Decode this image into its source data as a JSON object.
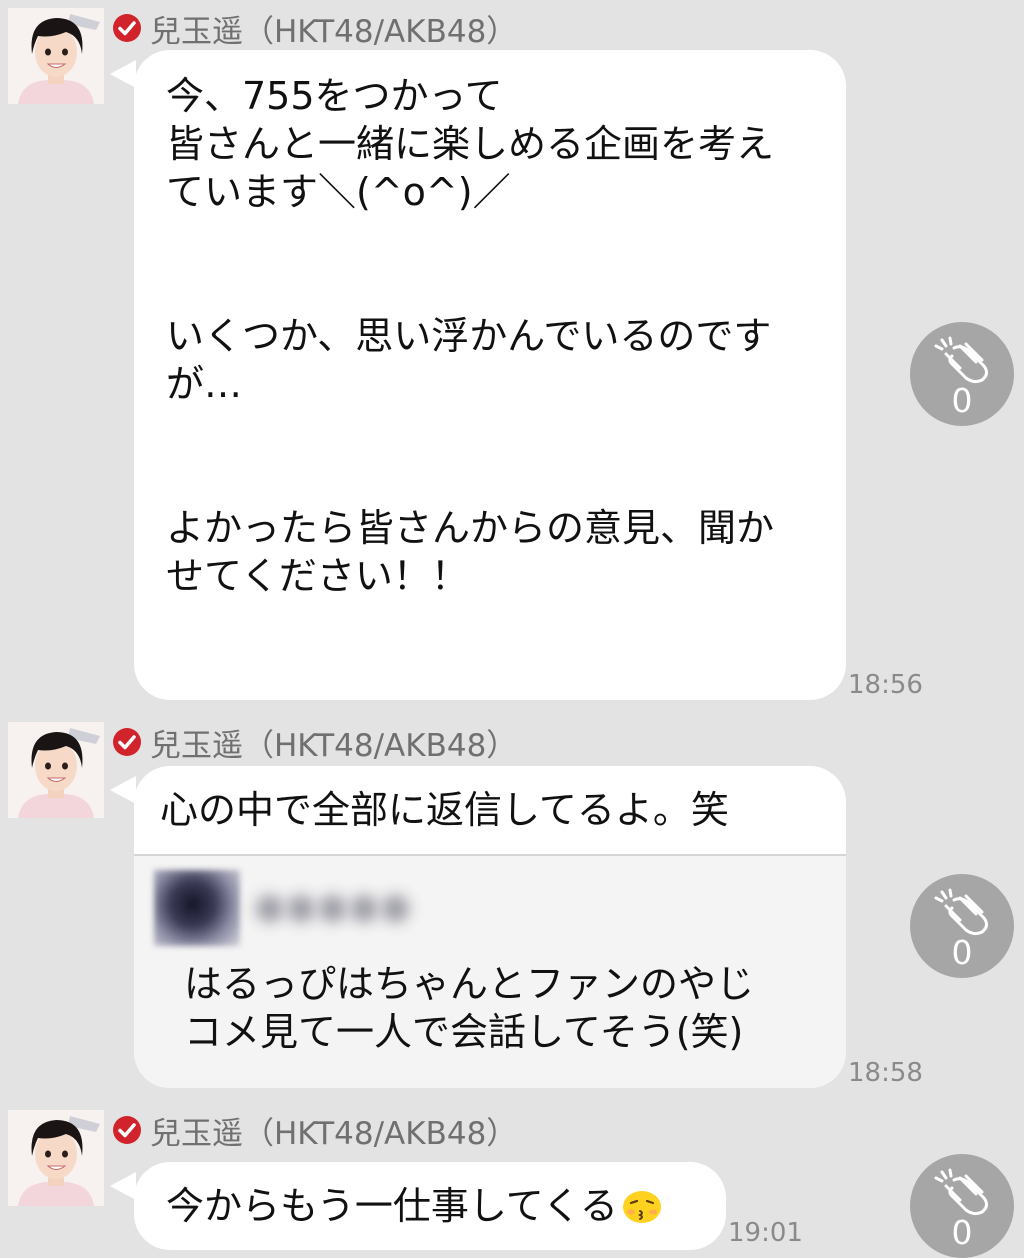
{
  "colors": {
    "background": "#e3e3e3",
    "bubble": "#ffffff",
    "verified_badge": "#d0232b",
    "clap_button": "#a6a6a6",
    "name_text": "#707070",
    "timestamp_text": "#8a8a8a"
  },
  "messages": [
    {
      "sender": "兒玉遥（HKT48/AKB48）",
      "avatar_icon": "profile-photo",
      "text": "今、755をつかって\n皆さんと一緒に楽しめる企画を考え\nています＼(^o^)／\n\n\nいくつか、思い浮かんでいるのです\nが…\n\n\nよかったら皆さんからの意見、聞か\nせてください！！",
      "time": "18:56",
      "clap_icon": "clap-icon",
      "clap_count": "0"
    },
    {
      "sender": "兒玉遥（HKT48/AKB48）",
      "avatar_icon": "profile-photo",
      "text": "心の中で全部に返信してるよ。笑",
      "quote": {
        "user": "●●●●●",
        "text": "はるっぴはちゃんとファンのやじ\nコメ見て一人で会話してそう(笑)"
      },
      "time": "18:58",
      "clap_icon": "clap-icon",
      "clap_count": "0"
    },
    {
      "sender": "兒玉遥（HKT48/AKB48）",
      "avatar_icon": "profile-photo",
      "text": "今からもう一仕事してくる",
      "emoji_icon": "kissing-face-emoji",
      "time": "19:01",
      "clap_icon": "clap-icon",
      "clap_count": "0"
    }
  ]
}
